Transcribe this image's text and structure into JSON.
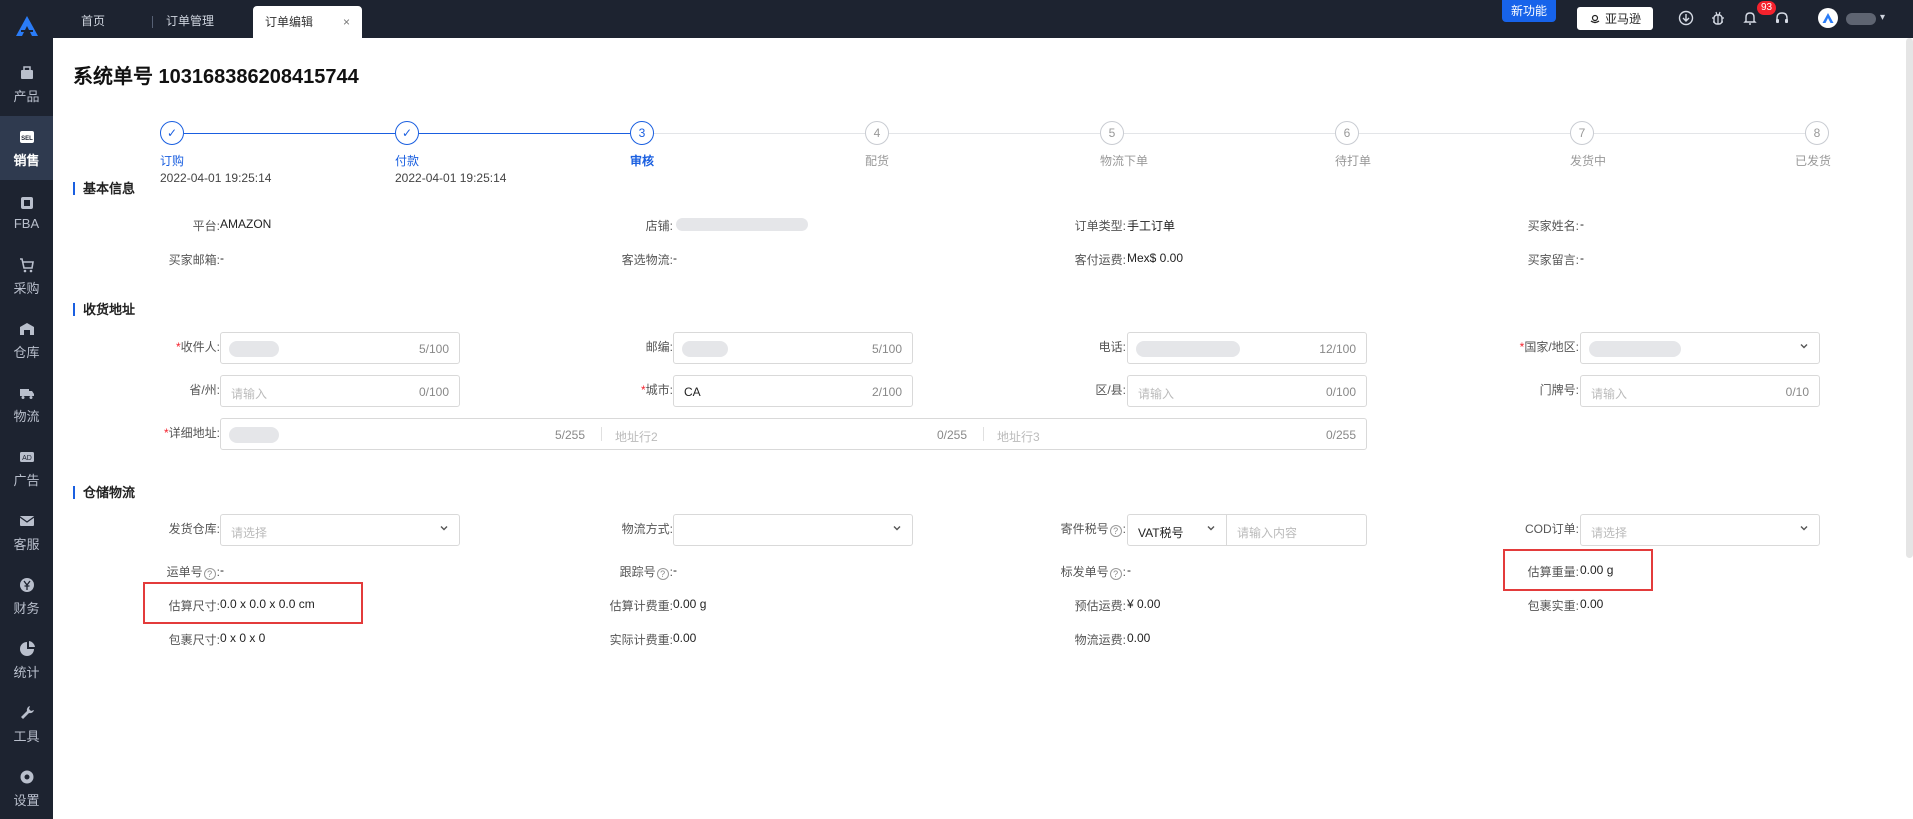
{
  "sidebar": {
    "items": [
      {
        "label": "产品",
        "icon": "box-icon"
      },
      {
        "label": "销售",
        "icon": "sell-tag-icon",
        "active": true
      },
      {
        "label": "FBA",
        "icon": "fba-icon"
      },
      {
        "label": "采购",
        "icon": "cart-icon"
      },
      {
        "label": "仓库",
        "icon": "warehouse-icon"
      },
      {
        "label": "物流",
        "icon": "truck-icon"
      },
      {
        "label": "广告",
        "icon": "ad-icon"
      },
      {
        "label": "客服",
        "icon": "mail-icon"
      },
      {
        "label": "财务",
        "icon": "yen-icon"
      },
      {
        "label": "统计",
        "icon": "pie-chart-icon"
      },
      {
        "label": "工具",
        "icon": "wrench-icon"
      },
      {
        "label": "设置",
        "icon": "gear-icon"
      }
    ]
  },
  "tabs": {
    "home": "首页",
    "order_mgmt": "订单管理",
    "order_edit": "订单编辑",
    "close": "×"
  },
  "topbar": {
    "new_feature": "新功能",
    "amazon": "亚马逊",
    "notification_count": "93",
    "caret": "▾"
  },
  "page": {
    "title": "系统单号 103168386208415744"
  },
  "steps": [
    {
      "num": "✓",
      "label": "订购",
      "time": "2022-04-01 19:25:14",
      "state": "done"
    },
    {
      "num": "✓",
      "label": "付款",
      "time": "2022-04-01 19:25:14",
      "state": "done"
    },
    {
      "num": "3",
      "label": "审核",
      "time": "",
      "state": "cur"
    },
    {
      "num": "4",
      "label": "配货",
      "time": "",
      "state": "todo"
    },
    {
      "num": "5",
      "label": "物流下单",
      "time": "",
      "state": "todo"
    },
    {
      "num": "6",
      "label": "待打单",
      "time": "",
      "state": "todo"
    },
    {
      "num": "7",
      "label": "发货中",
      "time": "",
      "state": "todo"
    },
    {
      "num": "8",
      "label": "已发货",
      "time": "",
      "state": "todo"
    }
  ],
  "basic": {
    "title": "基本信息",
    "platform_label": "平台:",
    "platform": "AMAZON",
    "shop_label": "店铺:",
    "order_type_label": "订单类型:",
    "order_type": "手工订单",
    "buyer_name_label": "买家姓名:",
    "buyer_name": "-",
    "buyer_email_label": "买家邮箱:",
    "buyer_email": "-",
    "customer_logistics_label": "客选物流:",
    "customer_logistics": "-",
    "customer_shipping_label": "客付运费:",
    "customer_shipping": "Mex$ 0.00",
    "buyer_msg_label": "买家留言:",
    "buyer_msg": "-"
  },
  "address": {
    "title": "收货地址",
    "receiver_label": "收件人:",
    "receiver_count": "5/100",
    "zip_label": "邮编:",
    "zip_count": "5/100",
    "phone_label": "电话:",
    "phone_count": "12/100",
    "country_label": "国家/地区:",
    "state_label": "省/州:",
    "state_placeholder": "请输入",
    "state_count": "0/100",
    "city_label": "城市:",
    "city_value": "CA",
    "city_count": "2/100",
    "district_label": "区/县:",
    "district_placeholder": "请输入",
    "district_count": "0/100",
    "door_label": "门牌号:",
    "door_placeholder": "请输入",
    "door_count": "0/10",
    "detail_label": "详细地址:",
    "detail_count": "5/255",
    "line2_placeholder": "地址行2",
    "line2_count": "0/255",
    "line3_placeholder": "地址行3",
    "line3_count": "0/255",
    "required_mark": "*"
  },
  "logistics": {
    "title": "仓储物流",
    "warehouse_label": "发货仓库:",
    "warehouse_placeholder": "请选择",
    "method_label": "物流方式:",
    "tax_label": "寄件税号",
    "tax_type": "VAT税号",
    "tax_placeholder": "请输入内容",
    "cod_label": "COD订单:",
    "cod_placeholder": "请选择",
    "waybill_label": "运单号",
    "waybill": "-",
    "tracking_label": "跟踪号",
    "tracking": "-",
    "mark_label": "标发单号",
    "mark": "-",
    "est_weight_label": "估算重量:",
    "est_weight": "0.00 g",
    "est_size_label": "估算尺寸:",
    "est_size": "0.0 x 0.0 x 0.0 cm",
    "est_charge_weight_label": "估算计费重:",
    "est_charge_weight": "0.00 g",
    "est_freight_label": "预估运费:",
    "est_freight": "¥ 0.00",
    "pkg_weight_label": "包裹实重:",
    "pkg_weight": "0.00",
    "pkg_size_label": "包裹尺寸:",
    "pkg_size": "0 x 0 x 0",
    "actual_charge_label": "实际计费重:",
    "actual_charge": "0.00",
    "freight_label": "物流运费:",
    "freight": "0.00",
    "help": "?",
    "colon": ":"
  }
}
